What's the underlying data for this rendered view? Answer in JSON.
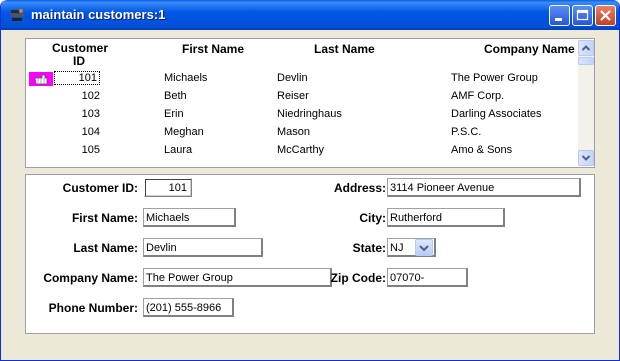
{
  "window": {
    "title": "maintain customers:1"
  },
  "grid": {
    "headers": {
      "id": "Customer ID",
      "first": "First Name",
      "last": "Last Name",
      "company": "Company Name"
    },
    "rows": [
      {
        "id": "101",
        "first": "Michaels",
        "last": "Devlin",
        "company": "The Power Group"
      },
      {
        "id": "102",
        "first": "Beth",
        "last": "Reiser",
        "company": "AMF Corp."
      },
      {
        "id": "103",
        "first": "Erin",
        "last": "Niedringhaus",
        "company": "Darling Associates"
      },
      {
        "id": "104",
        "first": "Meghan",
        "last": "Mason",
        "company": "P.S.C."
      },
      {
        "id": "105",
        "first": "Laura",
        "last": "McCarthy",
        "company": "Amo & Sons"
      }
    ]
  },
  "form": {
    "customer_id": {
      "label": "Customer ID:",
      "value": "101"
    },
    "first_name": {
      "label": "First Name:",
      "value": "Michaels"
    },
    "last_name": {
      "label": "Last Name:",
      "value": "Devlin"
    },
    "company_name": {
      "label": "Company Name:",
      "value": "The Power Group"
    },
    "phone_number": {
      "label": "Phone Number:",
      "value": "(201) 555-8966"
    },
    "address": {
      "label": "Address:",
      "value": "3114 Pioneer Avenue"
    },
    "city": {
      "label": "City:",
      "value": "Rutherford"
    },
    "state": {
      "label": "State:",
      "value": "NJ"
    },
    "zip_code": {
      "label": "Zip Code:",
      "value": "07070-"
    }
  }
}
